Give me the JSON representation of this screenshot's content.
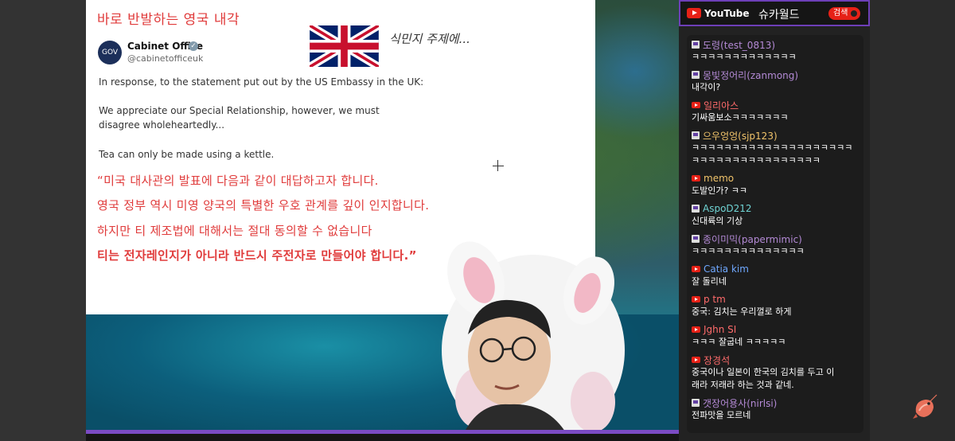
{
  "tweet": {
    "headline": "바로 반발하는 영국 내각",
    "caption": "식민지 주제에...",
    "avatar_label": "GOV",
    "account_name": "Cabinet Office",
    "account_handle": "@cabinetofficeuk",
    "text_en": [
      "In response, to the statement put out by the US Embassy in the UK:",
      "We appreciate our Special Relationship, however, we must disagree wholeheartedly...",
      "Tea can only be made using a kettle."
    ],
    "text_ko": [
      "“미국 대사관의 발표에 다음과 같이 대답하고자 합니다.",
      "영국 정부 역시 미영 양국의 특별한 우호 관계를 깊이 인지합니다.",
      "하지만 티 제조법에 대해서는 절대 동의할 수 없습니다",
      "티는 전자레인지가 아니라 반드시 주전자로 만들어야 합니다.”"
    ]
  },
  "chat": {
    "platform_label": "YouTube",
    "channel": "슈카월드",
    "search_label": "검색",
    "messages": [
      {
        "platform": "twitch",
        "user": "도령(test_0813)",
        "text": "ㅋㅋㅋㅋㅋㅋㅋㅋㅋㅋㅋㅋㅋ",
        "color": "#b48ad6"
      },
      {
        "platform": "twitch",
        "user": "몽빛정어리(zanmong)",
        "text": "내각이?",
        "color": "#b48ad6"
      },
      {
        "platform": "youtube",
        "user": "일리아스",
        "text": "기싸움보소ㅋㅋㅋㅋㅋㅋㅋ",
        "color": "#ff6b6b"
      },
      {
        "platform": "twitch",
        "user": "으우엉엉(sjp123)",
        "text": "ㅋㅋㅋㅋㅋㅋㅋㅋㅋㅋㅋㅋㅋㅋㅋㅋㅋㅋㅋㅋ",
        "text2": "ㅋㅋㅋㅋㅋㅋㅋㅋㅋㅋㅋㅋㅋㅋㅋㅋ",
        "color": "#f0c36a"
      },
      {
        "platform": "youtube",
        "user": "memo",
        "text": "도발인가? ㅋㅋ",
        "color": "#f0c36a"
      },
      {
        "platform": "twitch",
        "user": "AspoD212",
        "text": "신대륙의 기상",
        "color": "#6fd3d3"
      },
      {
        "platform": "twitch",
        "user": "종이미믹(papermimic)",
        "text": "ㅋㅋㅋㅋㅋㅋㅋㅋㅋㅋㅋㅋㅋㅋ",
        "color": "#b48ad6"
      },
      {
        "platform": "youtube",
        "user": "Catia kim",
        "text": "잘 돌리네",
        "color": "#6fa8ff"
      },
      {
        "platform": "youtube",
        "user": "p tm",
        "text": "중국: 김치는 우리껄로 하게",
        "color": "#ff6b6b"
      },
      {
        "platform": "youtube",
        "user": "Jghn SI",
        "text": "ㅋㅋㅋ 잘굽네 ㅋㅋㅋㅋㅋ",
        "color": "#ff6b6b"
      },
      {
        "platform": "youtube",
        "user": "장경석",
        "text": "중국이나 일본이 한국의 김치를 두고 이",
        "text2": "래라 저래라 하는 것과 같네.",
        "color": "#ff6b6b"
      },
      {
        "platform": "twitch",
        "user": "갯장어용사(nirlsi)",
        "text": "전파맛을 모르네",
        "color": "#b48ad6"
      }
    ]
  },
  "colors": {
    "accent_purple": "#7b4bc4",
    "headline_red": "#e03b3b",
    "youtube_red": "#e62117"
  }
}
